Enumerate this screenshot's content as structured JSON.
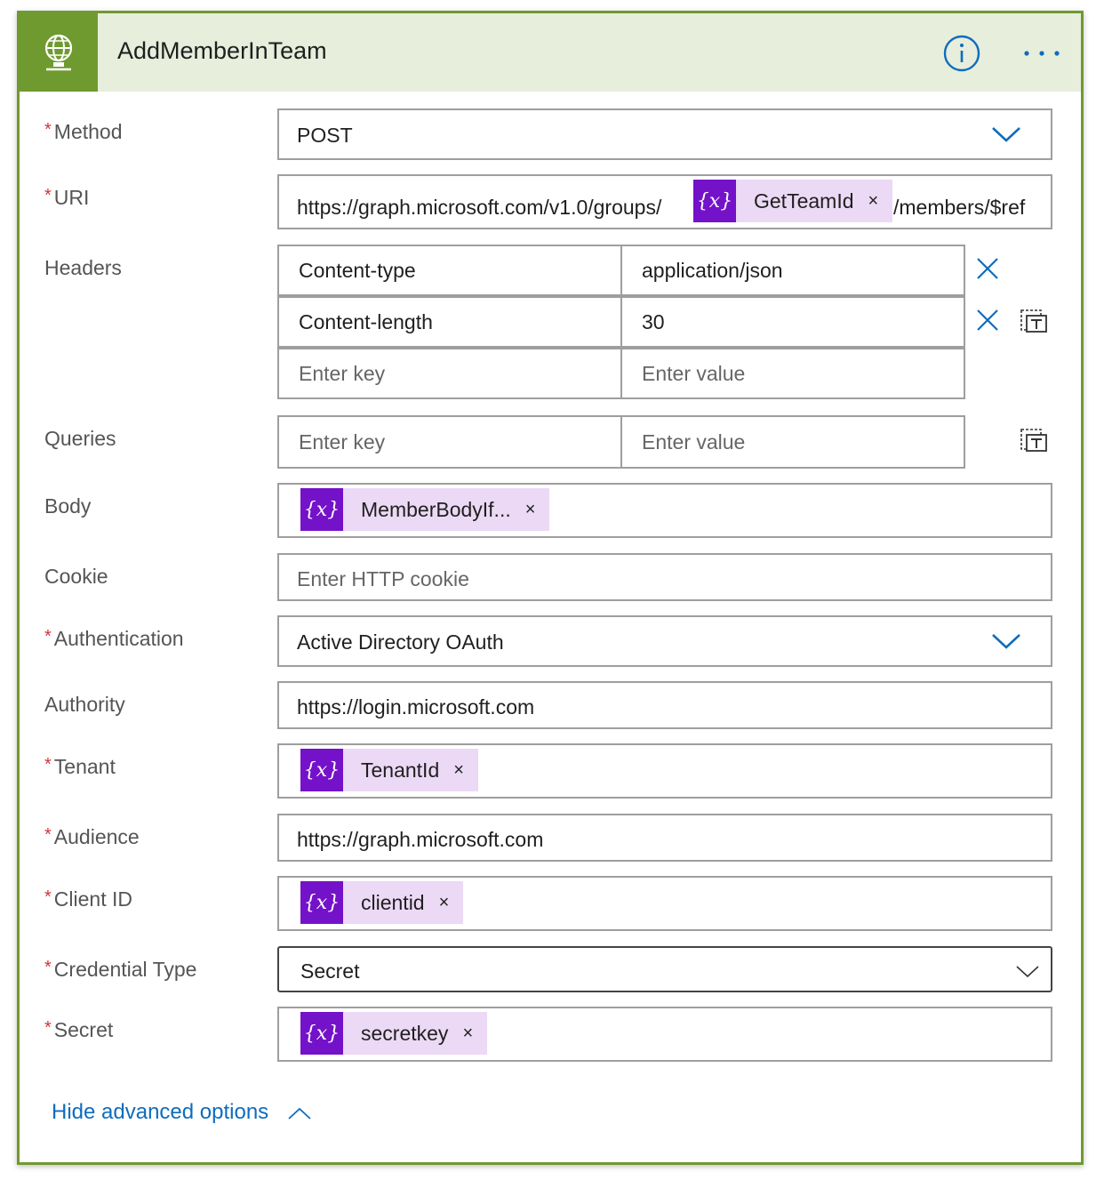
{
  "header": {
    "title": "AddMemberInTeam",
    "app_icon": "http-globe-icon",
    "info_icon": "info-icon",
    "more_icon": "more-icon",
    "accent_color": "#6f9a2f",
    "header_bg": "#e7eedc"
  },
  "fields": {
    "method": {
      "label": "Method",
      "required": "*",
      "value": "POST"
    },
    "uri": {
      "label": "URI",
      "required": "*",
      "prefix": "https://graph.microsoft.com/v1.0/groups/",
      "token": "GetTeamId",
      "suffix": "/members/$ref"
    },
    "headers": {
      "label": "Headers",
      "rows": [
        {
          "key": "Content-type",
          "value": "application/json"
        },
        {
          "key": "Content-length",
          "value": "30"
        }
      ],
      "key_placeholder": "Enter key",
      "value_placeholder": "Enter value"
    },
    "queries": {
      "label": "Queries",
      "key_placeholder": "Enter key",
      "value_placeholder": "Enter value"
    },
    "body": {
      "label": "Body",
      "token": "MemberBodyIf..."
    },
    "cookie": {
      "label": "Cookie",
      "placeholder": "Enter HTTP cookie"
    },
    "authentication": {
      "label": "Authentication",
      "required": "*",
      "value": "Active Directory OAuth"
    },
    "authority": {
      "label": "Authority",
      "value": "https://login.microsoft.com"
    },
    "tenant": {
      "label": "Tenant",
      "required": "*",
      "token": "TenantId"
    },
    "audience": {
      "label": "Audience",
      "required": "*",
      "value": "https://graph.microsoft.com"
    },
    "client_id": {
      "label": "Client ID",
      "required": "*",
      "token": "clientid"
    },
    "credential_type": {
      "label": "Credential Type",
      "required": "*",
      "value": "Secret"
    },
    "secret": {
      "label": "Secret",
      "required": "*",
      "token": "secretkey"
    }
  },
  "token_glyph": "{x}",
  "token_remove": "×",
  "token_color": "#7412c9",
  "footer": {
    "hide_advanced": "Hide advanced options"
  }
}
